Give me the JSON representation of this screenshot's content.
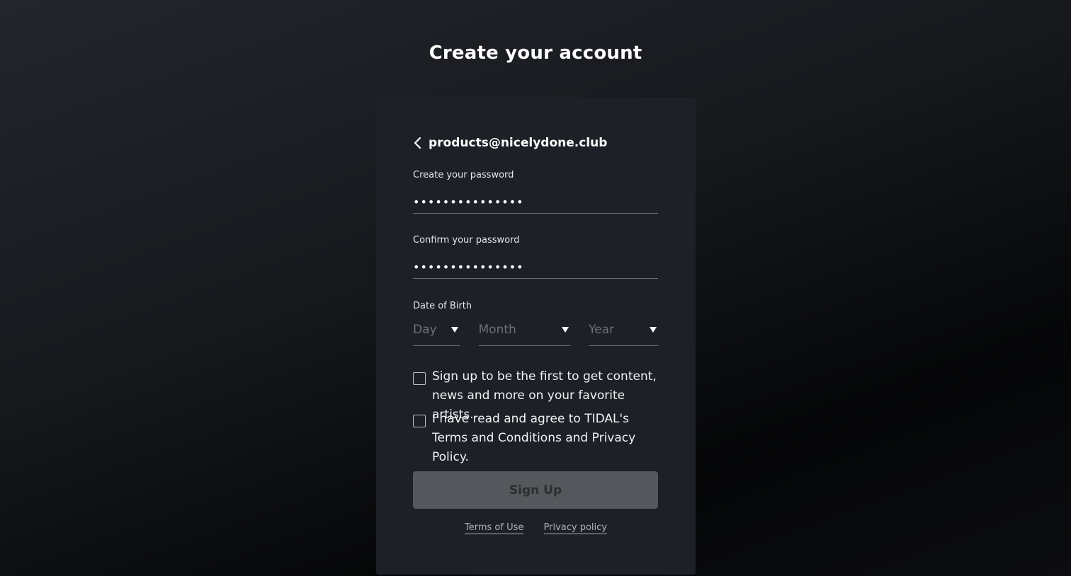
{
  "page": {
    "title": "Create your account"
  },
  "account": {
    "email": "products@nicelydone.club"
  },
  "password": {
    "label": "Create your password",
    "value": "•••••••••••••••"
  },
  "confirm_password": {
    "label": "Confirm your password",
    "value": "•••••••••••••••"
  },
  "dob": {
    "label": "Date of Birth",
    "day_placeholder": "Day",
    "month_placeholder": "Month",
    "year_placeholder": "Year"
  },
  "consents": {
    "marketing_text": "Sign up to be the first to get content, news and more on your favorite artists.",
    "terms_text": "I have read and agree to TIDAL's Terms and Conditions and Privacy Policy."
  },
  "actions": {
    "signup_label": "Sign Up"
  },
  "footer": {
    "terms_link": "Terms of Use",
    "privacy_link": "Privacy policy"
  },
  "icons": {
    "back": "chevron-left-icon",
    "dropdown": "caret-down-icon"
  },
  "colors": {
    "card_bg": "#1d2026",
    "button_disabled_bg": "#54575c",
    "placeholder": "#6e717a"
  }
}
